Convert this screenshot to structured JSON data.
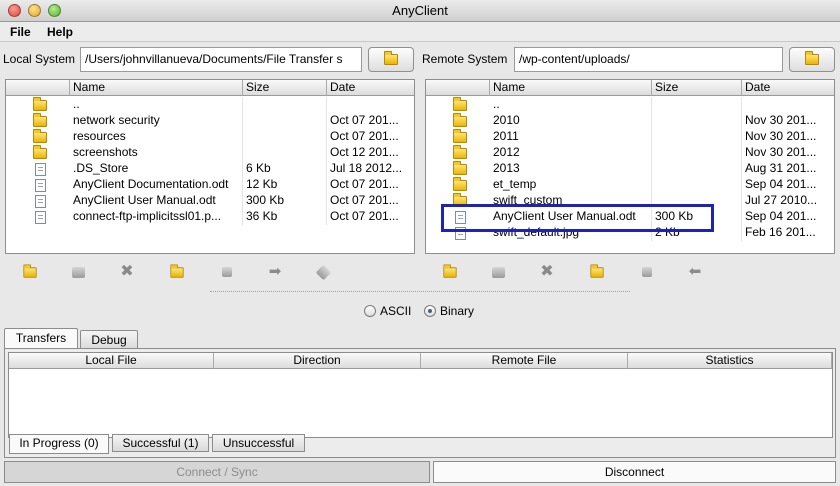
{
  "window": {
    "title": "AnyClient"
  },
  "menu": {
    "file": "File",
    "help": "Help"
  },
  "local": {
    "label": "Local System",
    "path": "/Users/johnvillanueva/Documents/File Transfer s",
    "columns": [
      "Name",
      "Size",
      "Date"
    ],
    "rows": [
      {
        "icon": "folder-icon",
        "name": "..",
        "size": "",
        "date": ""
      },
      {
        "icon": "folder-icon",
        "name": "network security",
        "size": "",
        "date": "Oct 07 201..."
      },
      {
        "icon": "folder-icon",
        "name": "resources",
        "size": "",
        "date": "Oct 07 201..."
      },
      {
        "icon": "folder-icon",
        "name": "screenshots",
        "size": "",
        "date": "Oct 12 201..."
      },
      {
        "icon": "file-icon",
        "name": ".DS_Store",
        "size": "6 Kb",
        "date": "Jul 18 2012..."
      },
      {
        "icon": "file-icon",
        "name": "AnyClient Documentation.odt",
        "size": "12 Kb",
        "date": "Oct 07 201..."
      },
      {
        "icon": "file-icon",
        "name": "AnyClient User Manual.odt",
        "size": "300 Kb",
        "date": "Oct 07 201..."
      },
      {
        "icon": "file-icon",
        "name": "connect-ftp-implicitssl01.p...",
        "size": "36 Kb",
        "date": "Oct 07 201..."
      }
    ]
  },
  "remote": {
    "label": "Remote System",
    "path": "/wp-content/uploads/",
    "columns": [
      "Name",
      "Size",
      "Date"
    ],
    "rows": [
      {
        "icon": "folder-icon",
        "name": "..",
        "size": "",
        "date": ""
      },
      {
        "icon": "folder-icon",
        "name": "2010",
        "size": "",
        "date": "Nov 30 201..."
      },
      {
        "icon": "folder-icon",
        "name": "2011",
        "size": "",
        "date": "Nov 30 201..."
      },
      {
        "icon": "folder-icon",
        "name": "2012",
        "size": "",
        "date": "Nov 30 201..."
      },
      {
        "icon": "folder-icon",
        "name": "2013",
        "size": "",
        "date": "Aug 31 201..."
      },
      {
        "icon": "folder-icon",
        "name": "et_temp",
        "size": "",
        "date": "Sep 04 201..."
      },
      {
        "icon": "folder-icon",
        "name": "swift_custom",
        "size": "",
        "date": "Jul 27 2010..."
      },
      {
        "icon": "file-icon",
        "name": "AnyClient User Manual.odt",
        "size": "300 Kb",
        "date": "Sep 04 201..."
      },
      {
        "icon": "file-icon",
        "name": "swift_default.jpg",
        "size": "2 Kb",
        "date": "Feb 16 201..."
      }
    ]
  },
  "transfer_mode": {
    "ascii": "ASCII",
    "binary": "Binary",
    "selected": "Binary"
  },
  "tabs": {
    "transfers": "Transfers",
    "debug": "Debug"
  },
  "transfers_table": {
    "columns": [
      "Local File",
      "Direction",
      "Remote File",
      "Statistics"
    ]
  },
  "subtabs": {
    "in_progress": "In Progress (0)",
    "successful": "Successful (1)",
    "unsuccessful": "Unsuccessful"
  },
  "buttons": {
    "connect": "Connect / Sync",
    "disconnect": "Disconnect"
  }
}
